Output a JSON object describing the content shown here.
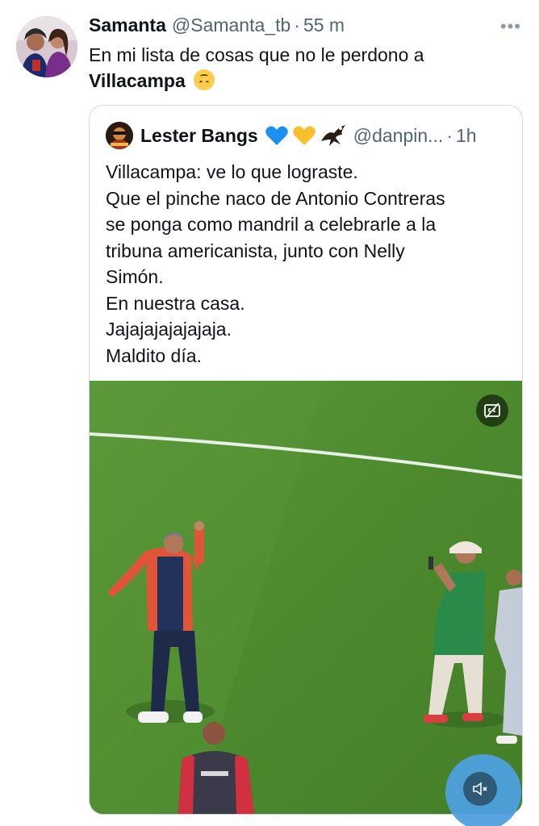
{
  "tweet": {
    "author_name": "Samanta",
    "author_handle": "@Samanta_tb",
    "separator": "·",
    "time": "55 m",
    "more_label": "•••",
    "text_line1": "En mi lista de cosas que no le perdono a",
    "text_bold": "Villacampa",
    "emoji": "upside-down-face"
  },
  "quote": {
    "author_name": "Lester Bangs",
    "author_emojis": [
      "blue-heart",
      "yellow-heart",
      "eagle"
    ],
    "author_handle": "@danpin...",
    "separator": "·",
    "time": "1h",
    "lines": [
      "Villacampa: ve lo que lograste.",
      "Que el pinche naco de Antonio Contreras",
      "se ponga como mandril a celebrarle a la",
      "tribuna americanista, junto con Nelly",
      "Simón.",
      "En nuestra casa.",
      "Jajajajajajajaja.",
      "Maldito día."
    ]
  },
  "media": {
    "type": "video",
    "description_icon": "closed-captions-icon",
    "mute_icon": "speaker-muted-icon"
  },
  "colors": {
    "text_primary": "#0f1419",
    "text_secondary": "#536471",
    "border": "#cfd9de",
    "grass": "#4f8a30",
    "mute_button": "#4fa0e0"
  }
}
